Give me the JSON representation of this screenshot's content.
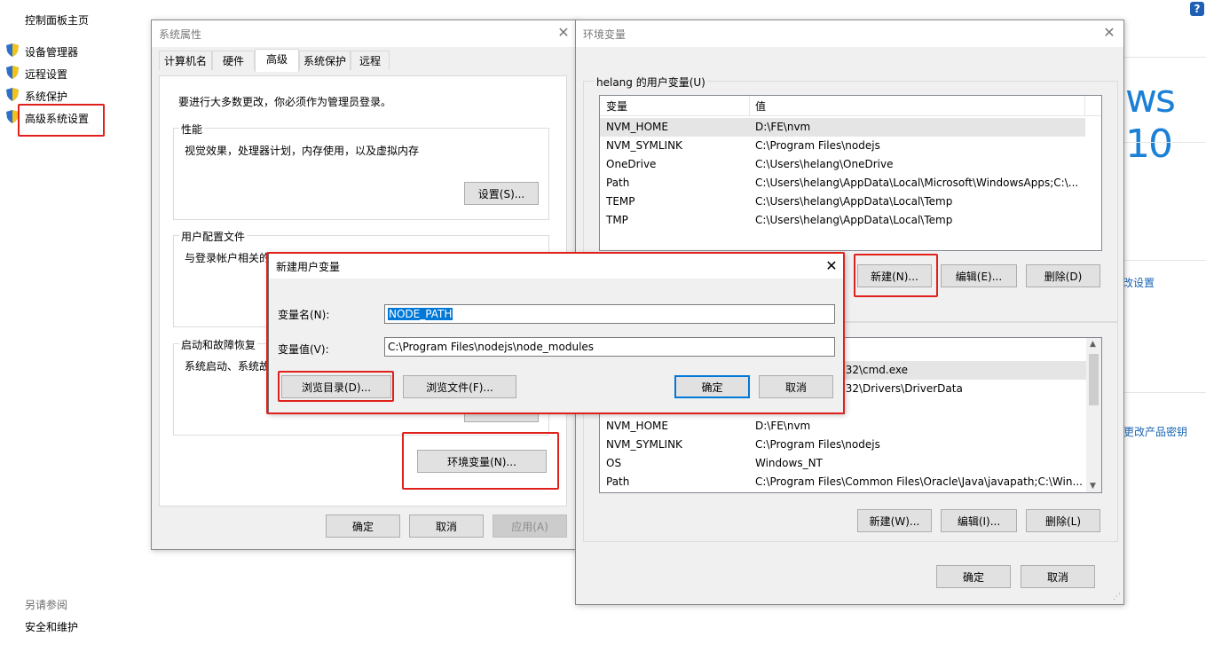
{
  "control_panel": {
    "home": "控制面板主页",
    "links": [
      "设备管理器",
      "远程设置",
      "系统保护",
      "高级系统设置"
    ],
    "see_also": "另请参阅",
    "security": "安全和维护",
    "windows_logo_text": "ws 10",
    "change_settings": "改设置",
    "change_product_key": "更改产品密钥",
    "help": "?"
  },
  "system_properties": {
    "title": "系统属性",
    "tabs": [
      "计算机名",
      "硬件",
      "高级",
      "系统保护",
      "远程"
    ],
    "admin_note": "要进行大多数更改，你必须作为管理员登录。",
    "performance": {
      "label": "性能",
      "desc": "视觉效果，处理器计划，内存使用，以及虚拟内存",
      "button": "设置(S)..."
    },
    "user_profiles": {
      "label": "用户配置文件",
      "desc": "与登录帐户相关的桌面设置"
    },
    "startup": {
      "label": "启动和故障恢复",
      "desc": "系统启动、系统故障和调试信息"
    },
    "env_button": "环境变量(N)...",
    "ok": "确定",
    "cancel": "取消",
    "apply": "应用(A)"
  },
  "env_vars": {
    "title": "环境变量",
    "user_section": "helang 的用户变量(U)",
    "col_var": "变量",
    "col_val": "值",
    "user_vars": [
      {
        "name": "NVM_HOME",
        "value": "D:\\FE\\nvm"
      },
      {
        "name": "NVM_SYMLINK",
        "value": "C:\\Program Files\\nodejs"
      },
      {
        "name": "OneDrive",
        "value": "C:\\Users\\helang\\OneDrive"
      },
      {
        "name": "Path",
        "value": "C:\\Users\\helang\\AppData\\Local\\Microsoft\\WindowsApps;C:\\..."
      },
      {
        "name": "TEMP",
        "value": "C:\\Users\\helang\\AppData\\Local\\Temp"
      },
      {
        "name": "TMP",
        "value": "C:\\Users\\helang\\AppData\\Local\\Temp"
      }
    ],
    "user_new": "新建(N)...",
    "user_edit": "编辑(E)...",
    "user_delete": "删除(D)",
    "sys_partial": [
      "m32\\cmd.exe",
      "m32\\Drivers\\DriverData"
    ],
    "sys_vars": [
      {
        "name": "NVM_HOME",
        "value": "D:\\FE\\nvm"
      },
      {
        "name": "NVM_SYMLINK",
        "value": "C:\\Program Files\\nodejs"
      },
      {
        "name": "OS",
        "value": "Windows_NT"
      },
      {
        "name": "Path",
        "value": "C:\\Program Files\\Common Files\\Oracle\\Java\\javapath;C:\\Win..."
      }
    ],
    "sys_new": "新建(W)...",
    "sys_edit": "编辑(I)...",
    "sys_delete": "删除(L)",
    "ok": "确定",
    "cancel": "取消"
  },
  "new_var_dialog": {
    "title": "新建用户变量",
    "name_label": "变量名(N):",
    "name_value": "NODE_PATH",
    "value_label": "变量值(V):",
    "value_value": "C:\\Program Files\\nodejs\\node_modules",
    "browse_dir": "浏览目录(D)...",
    "browse_file": "浏览文件(F)...",
    "ok": "确定",
    "cancel": "取消"
  }
}
